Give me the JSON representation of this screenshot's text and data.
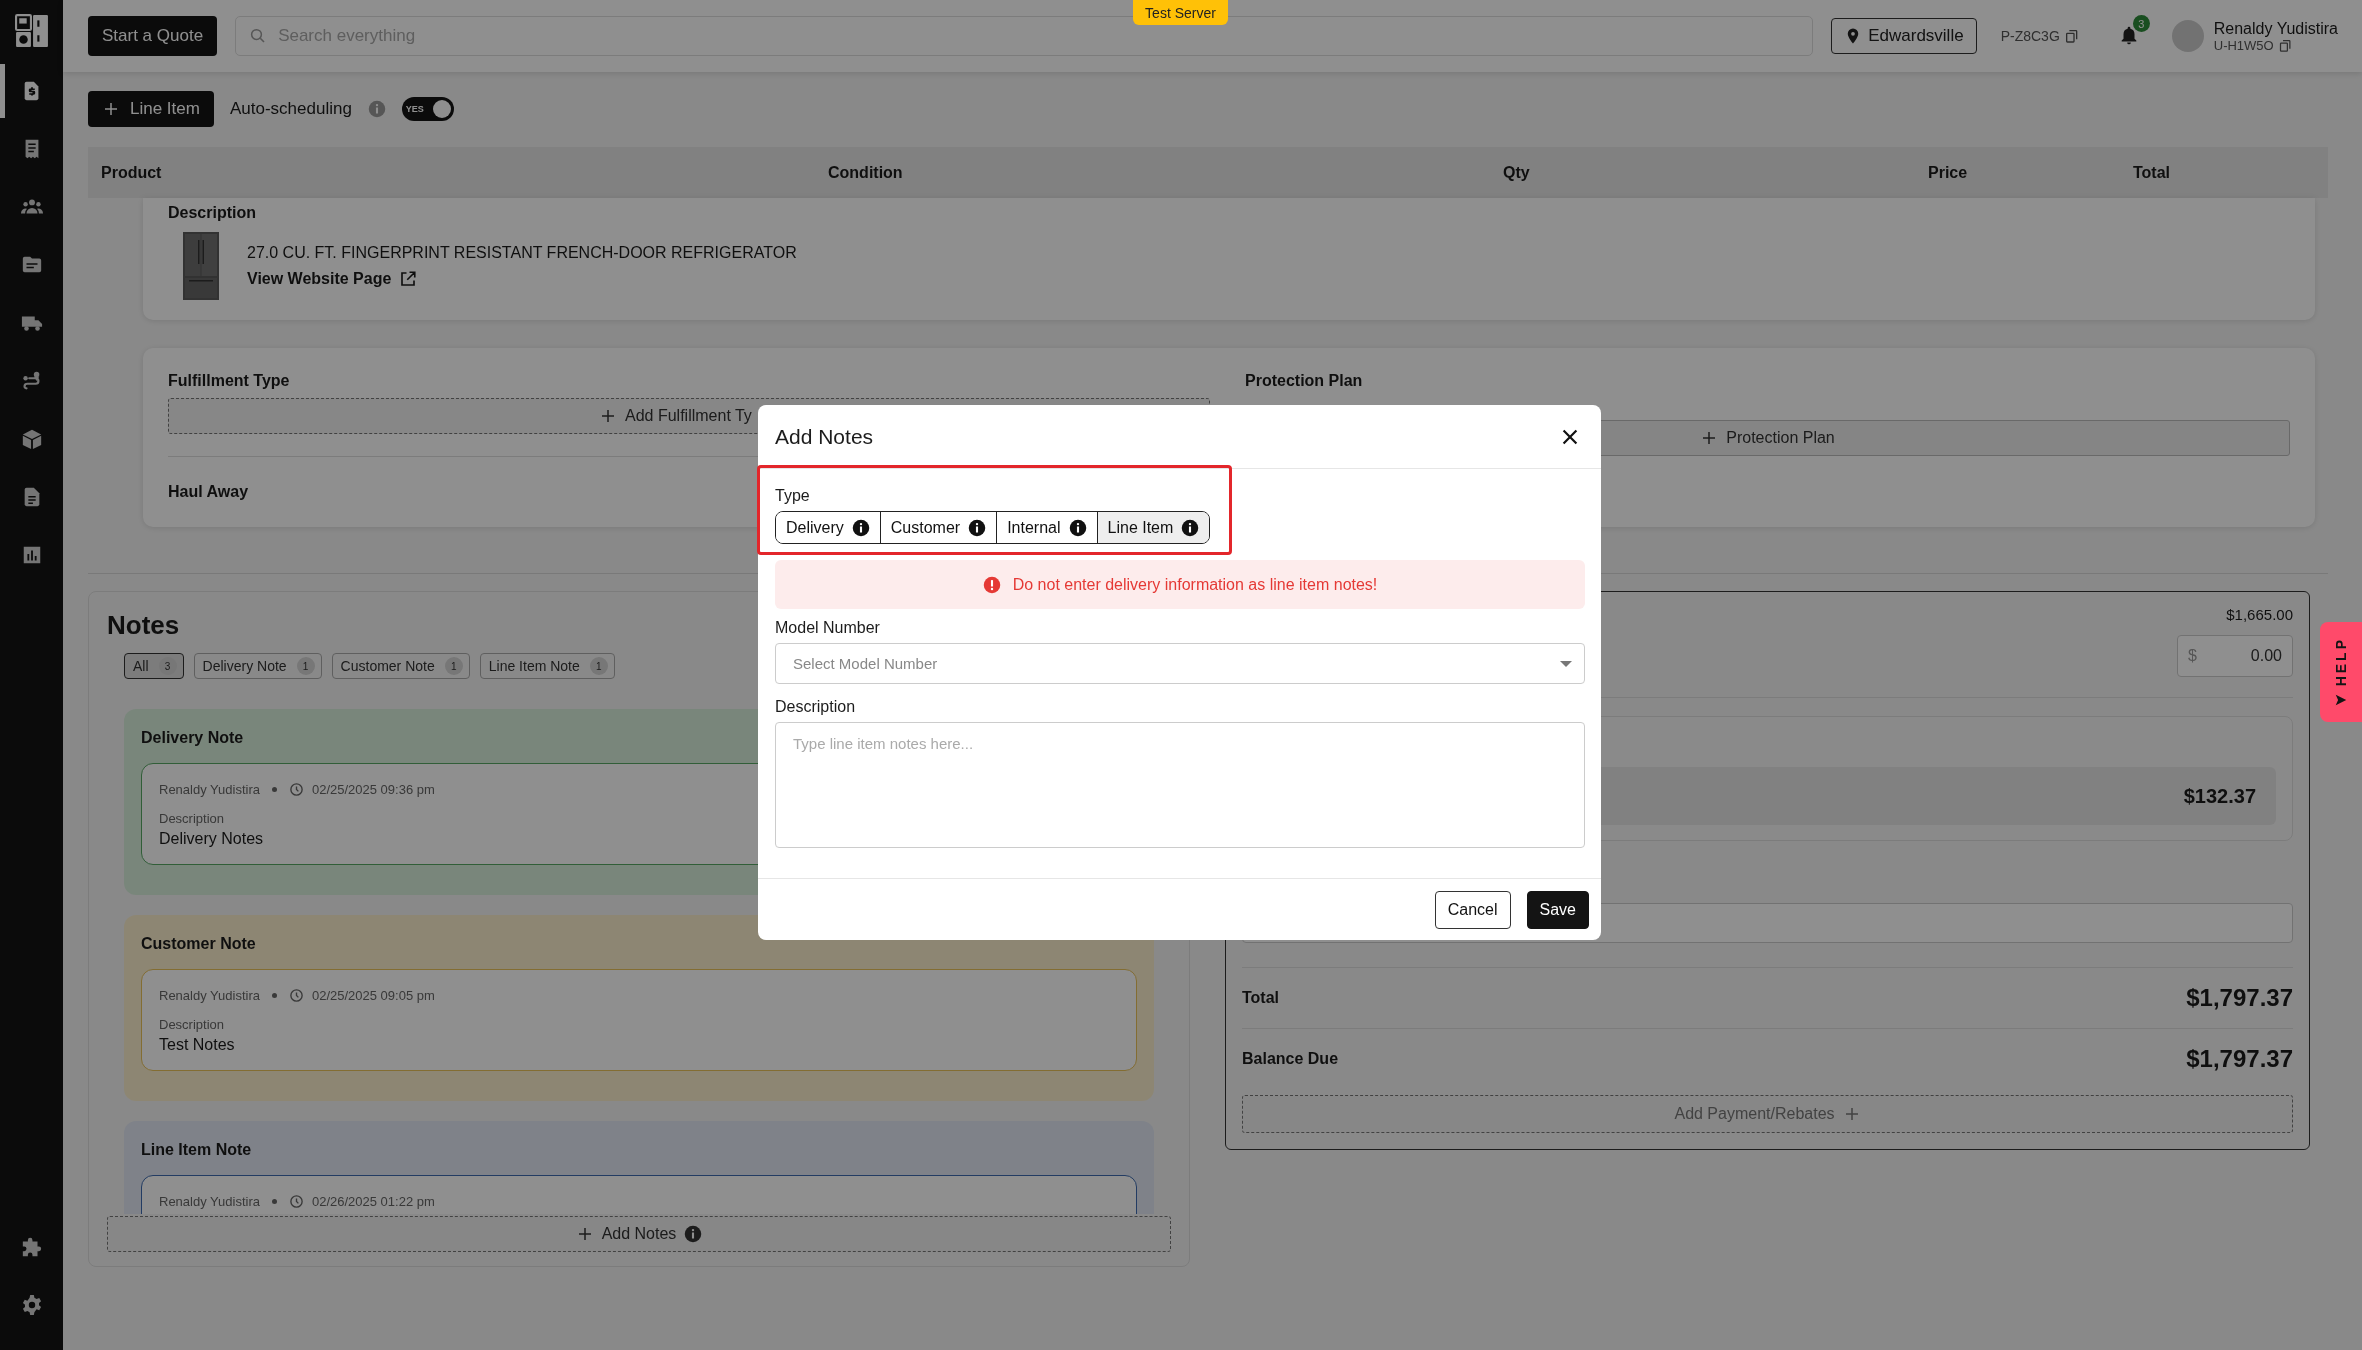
{
  "sidebar": {
    "items": [
      {
        "selected": true
      },
      {
        "selected": false
      },
      {
        "selected": false
      },
      {
        "selected": false
      },
      {
        "selected": false
      },
      {
        "selected": false
      },
      {
        "selected": false
      },
      {
        "selected": false
      },
      {
        "selected": false
      }
    ],
    "bottom_items": [
      {
        "selected": false
      },
      {
        "selected": false
      }
    ]
  },
  "test_server": "Test Server",
  "topbar": {
    "start_button": "Start a Quote",
    "search": {
      "placeholder": "Search everything"
    },
    "location": "Edwardsville",
    "code": "P-Z8C3G",
    "notification_count": "3",
    "user": {
      "name": "Renaldy Yudistira",
      "id": "U-H1W5O"
    }
  },
  "toolbar": {
    "add_button": "Line Item",
    "auto_scheduling": {
      "label": "Auto-scheduling",
      "on": true,
      "toggle_label": "YES"
    }
  },
  "table": {
    "columns": [
      "Product",
      "Condition",
      "Qty",
      "Price",
      "Total"
    ]
  },
  "line_item": {
    "description_label": "Description",
    "product_name": "27.0 CU. FT. FINGERPRINT RESISTANT FRENCH-DOOR REFRIGERATOR",
    "link": "View Website Page"
  },
  "fulfillment": {
    "fulfillment_type_label": "Fulfillment Type",
    "add_fulfillment_button": "Add Fulfillment Ty",
    "protection_plan_label": "Protection Plan",
    "protection_plan_button": "Protection Plan",
    "haul_away_label": "Haul Away"
  },
  "notes": {
    "title": "Notes",
    "filters": [
      {
        "label": "All",
        "count": "3",
        "selected": true
      },
      {
        "label": "Delivery Note",
        "count": "1",
        "selected": false
      },
      {
        "label": "Customer Note",
        "count": "1",
        "selected": false
      },
      {
        "label": "Line Item Note",
        "count": "1",
        "selected": false
      }
    ],
    "groups": [
      {
        "kind": "delivery",
        "title": "Delivery Note",
        "entries": [
          {
            "author": "Renaldy Yudistira",
            "time": "02/25/2025 09:36 pm",
            "description_label": "Description",
            "description": "Delivery Notes"
          }
        ]
      },
      {
        "kind": "customer",
        "title": "Customer Note",
        "entries": [
          {
            "author": "Renaldy Yudistira",
            "time": "02/25/2025 09:05 pm",
            "description_label": "Description",
            "description": "Test Notes"
          }
        ]
      },
      {
        "kind": "line_item",
        "title": "Line Item Note",
        "entries": [
          {
            "author": "Renaldy Yudistira",
            "time": "02/26/2025 01:22 pm"
          }
        ]
      }
    ],
    "add_button": "Add Notes"
  },
  "summary": {
    "subtotal": "$1,665.00",
    "discount_symbol": "$",
    "discount_value": "0.00",
    "fee_amount": "$132.37",
    "total_label": "Total",
    "total": "$1,797.37",
    "balance_label": "Balance Due",
    "balance": "$1,797.37",
    "payment_button": "Add Payment/Rebates"
  },
  "help": "HELP",
  "modal": {
    "title": "Add Notes",
    "type_label": "Type",
    "type_highlighted": true,
    "type_options": [
      {
        "label": "Delivery",
        "selected": false
      },
      {
        "label": "Customer",
        "selected": false
      },
      {
        "label": "Internal",
        "selected": false
      },
      {
        "label": "Line Item",
        "selected": true
      }
    ],
    "alert": "Do not enter delivery information as line item notes!",
    "model_label": "Model Number",
    "model_select": {
      "placeholder": "Select Model Number"
    },
    "description_label": "Description",
    "description_field": {
      "placeholder": "Type line item notes here..."
    },
    "buttons": [
      {
        "label": "Cancel",
        "kind": "secondary"
      },
      {
        "label": "Save",
        "kind": "primary"
      }
    ]
  }
}
